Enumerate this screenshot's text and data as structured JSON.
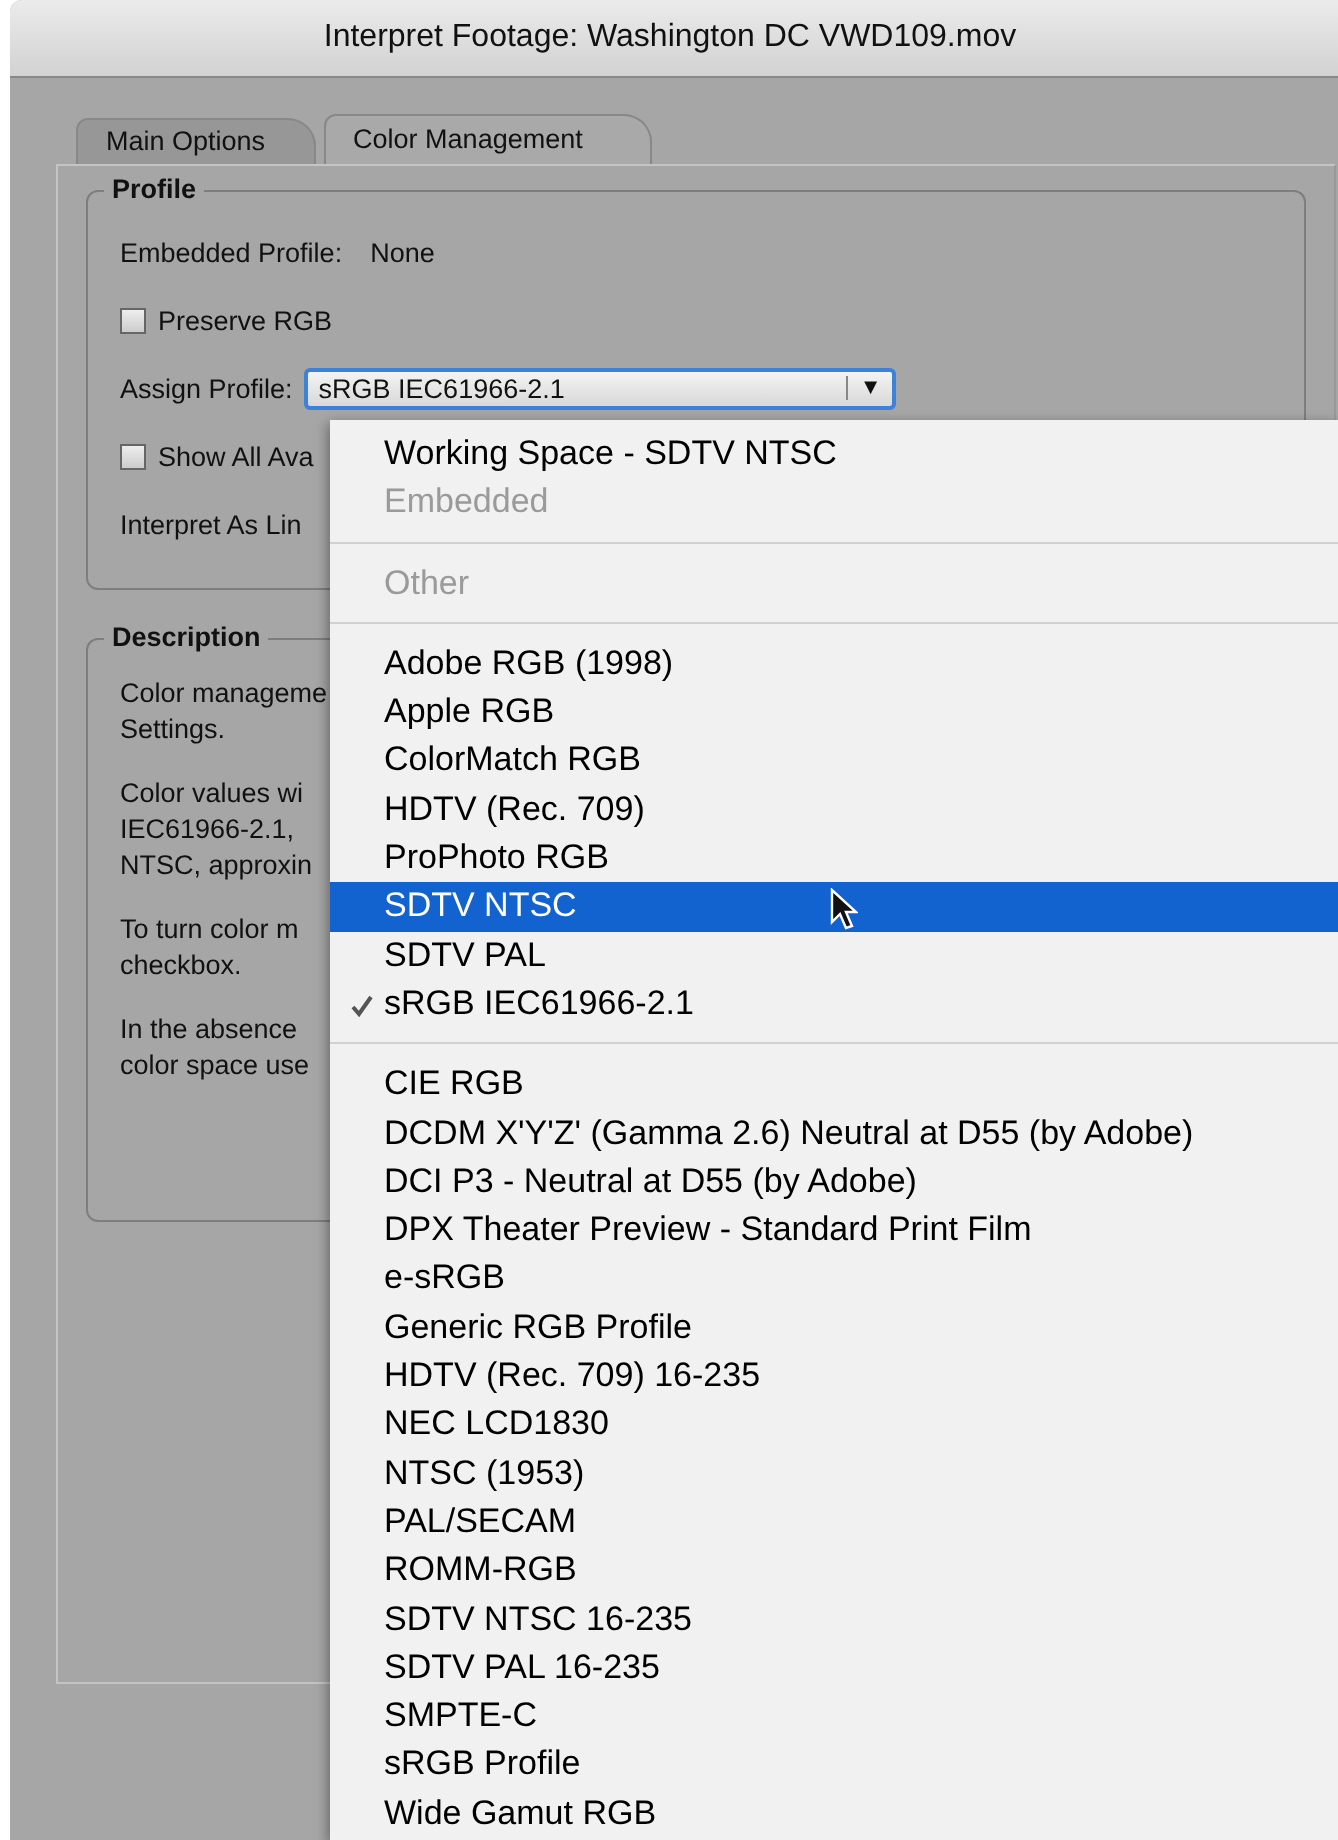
{
  "window": {
    "title": "Interpret Footage: Washington DC VWD109.mov"
  },
  "tabs": [
    {
      "label": "Main Options",
      "selected": false
    },
    {
      "label": "Color Management",
      "selected": true
    }
  ],
  "profile": {
    "legend": "Profile",
    "embedded_label": "Embedded Profile:",
    "embedded_value": "None",
    "preserve_rgb": {
      "label": "Preserve RGB",
      "checked": false
    },
    "assign_label": "Assign Profile:",
    "assign_value": "sRGB IEC61966-2.1",
    "assign_arrow": "▼",
    "show_all": {
      "label": "Show All Ava",
      "checked": false
    },
    "linear_label": "Interpret As Lin"
  },
  "description": {
    "legend": "Description",
    "paragraphs": [
      [
        "Color manageme",
        "Settings."
      ],
      [
        "Color values wi",
        "IEC61966-2.1,",
        "NTSC, approxin"
      ],
      [
        "To turn color m",
        "checkbox."
      ],
      [
        "In the absence",
        "color space use"
      ]
    ]
  },
  "menu": [
    {
      "kind": "item",
      "label": "Working Space - SDTV NTSC",
      "disabled": false,
      "selected": false,
      "checked": false
    },
    {
      "kind": "item",
      "label": "Embedded",
      "disabled": true,
      "selected": false,
      "checked": false
    },
    {
      "kind": "separator"
    },
    {
      "kind": "item",
      "label": "Other",
      "disabled": true,
      "selected": false,
      "checked": false
    },
    {
      "kind": "separator"
    },
    {
      "kind": "item",
      "label": "Adobe RGB (1998)",
      "disabled": false,
      "selected": false,
      "checked": false
    },
    {
      "kind": "item",
      "label": "Apple RGB",
      "disabled": false,
      "selected": false,
      "checked": false
    },
    {
      "kind": "item",
      "label": "ColorMatch RGB",
      "disabled": false,
      "selected": false,
      "checked": false
    },
    {
      "kind": "item",
      "label": "HDTV (Rec. 709)",
      "disabled": false,
      "selected": false,
      "checked": false
    },
    {
      "kind": "item",
      "label": "ProPhoto RGB",
      "disabled": false,
      "selected": false,
      "checked": false
    },
    {
      "kind": "item",
      "label": "SDTV NTSC",
      "disabled": false,
      "selected": true,
      "checked": false
    },
    {
      "kind": "item",
      "label": "SDTV PAL",
      "disabled": false,
      "selected": false,
      "checked": false
    },
    {
      "kind": "item",
      "label": "sRGB IEC61966-2.1",
      "disabled": false,
      "selected": false,
      "checked": true
    },
    {
      "kind": "separator"
    },
    {
      "kind": "item",
      "label": "CIE RGB",
      "disabled": false,
      "selected": false,
      "checked": false
    },
    {
      "kind": "item",
      "label": "DCDM X'Y'Z' (Gamma 2.6) Neutral at D55 (by Adobe)",
      "disabled": false,
      "selected": false,
      "checked": false
    },
    {
      "kind": "item",
      "label": "DCI P3 - Neutral at D55 (by Adobe)",
      "disabled": false,
      "selected": false,
      "checked": false
    },
    {
      "kind": "item",
      "label": "DPX Theater Preview - Standard Print Film",
      "disabled": false,
      "selected": false,
      "checked": false
    },
    {
      "kind": "item",
      "label": "e-sRGB",
      "disabled": false,
      "selected": false,
      "checked": false
    },
    {
      "kind": "item",
      "label": "Generic RGB Profile",
      "disabled": false,
      "selected": false,
      "checked": false
    },
    {
      "kind": "item",
      "label": "HDTV (Rec. 709) 16-235",
      "disabled": false,
      "selected": false,
      "checked": false
    },
    {
      "kind": "item",
      "label": "NEC LCD1830",
      "disabled": false,
      "selected": false,
      "checked": false
    },
    {
      "kind": "item",
      "label": "NTSC (1953)",
      "disabled": false,
      "selected": false,
      "checked": false
    },
    {
      "kind": "item",
      "label": "PAL/SECAM",
      "disabled": false,
      "selected": false,
      "checked": false
    },
    {
      "kind": "item",
      "label": "ROMM-RGB",
      "disabled": false,
      "selected": false,
      "checked": false
    },
    {
      "kind": "item",
      "label": "SDTV NTSC 16-235",
      "disabled": false,
      "selected": false,
      "checked": false
    },
    {
      "kind": "item",
      "label": "SDTV PAL 16-235",
      "disabled": false,
      "selected": false,
      "checked": false
    },
    {
      "kind": "item",
      "label": "SMPTE-C",
      "disabled": false,
      "selected": false,
      "checked": false
    },
    {
      "kind": "item",
      "label": "sRGB Profile",
      "disabled": false,
      "selected": false,
      "checked": false
    },
    {
      "kind": "item",
      "label": "Wide Gamut RGB",
      "disabled": false,
      "selected": false,
      "checked": false
    }
  ]
}
